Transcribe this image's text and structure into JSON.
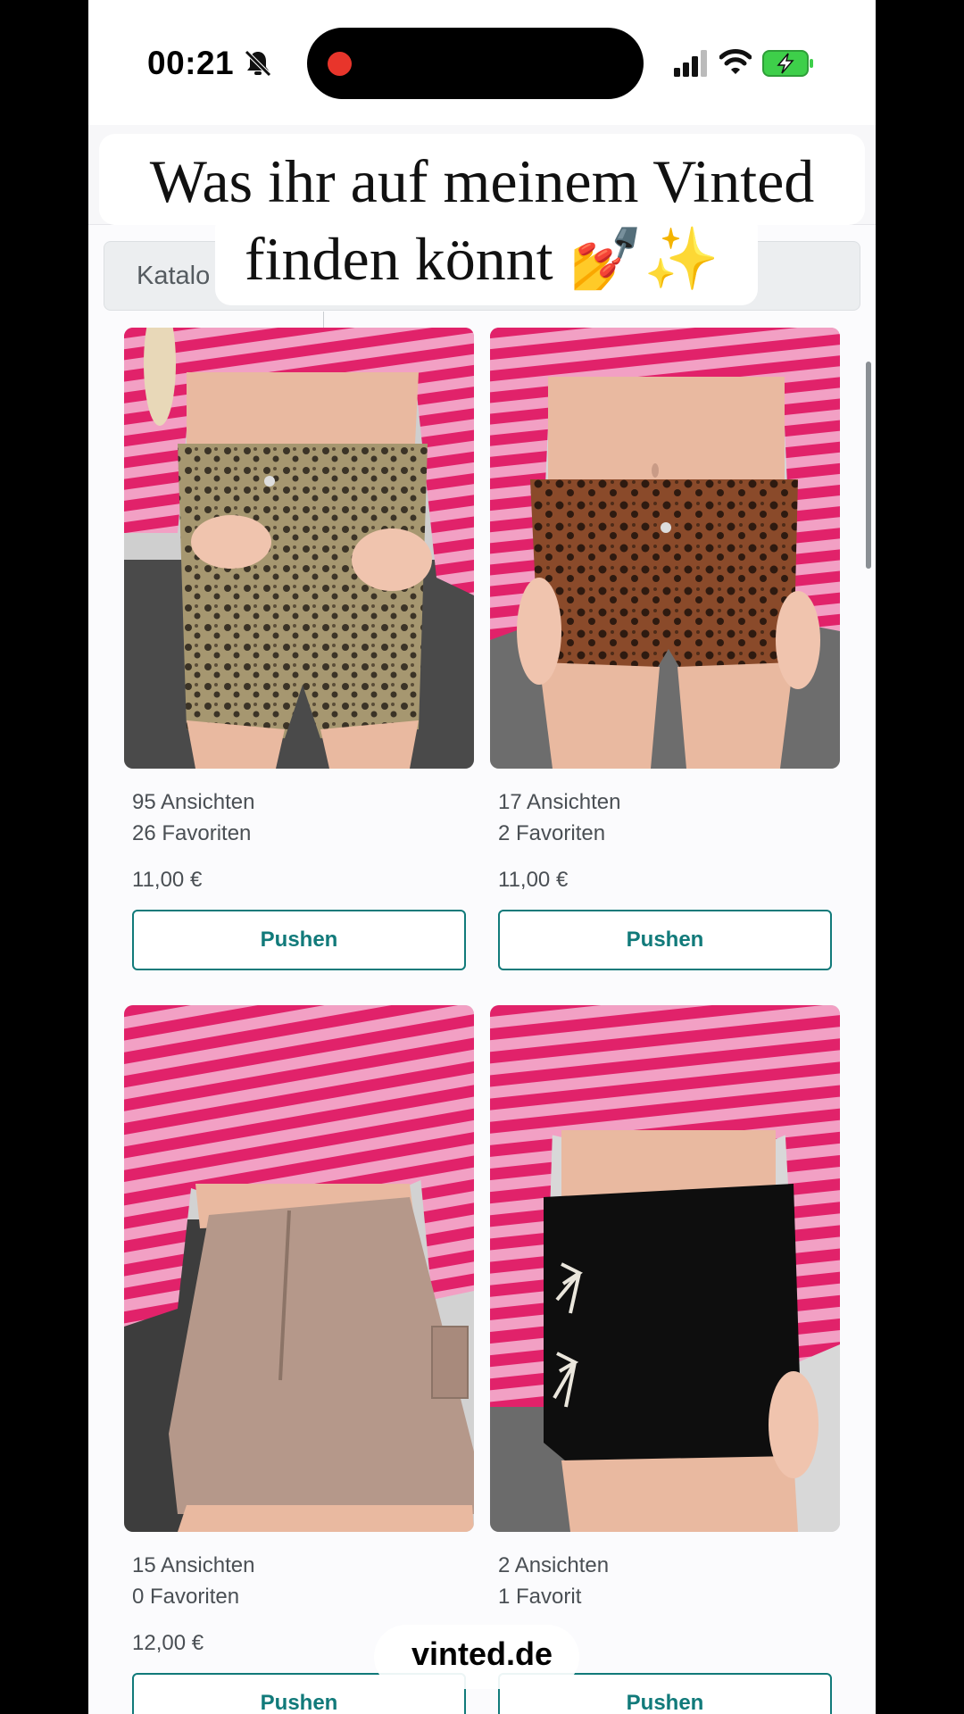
{
  "status_bar": {
    "time": "00:21",
    "icons": [
      "bell-slash-icon",
      "record-indicator-icon",
      "cellular-signal-icon",
      "wifi-icon",
      "battery-charging-icon"
    ],
    "battery_color": "#3ecf4a",
    "record_color": "#e8352b"
  },
  "search": {
    "label": "Katalo"
  },
  "caption": {
    "line1": "Was ihr auf meinem Vinted",
    "line2": "finden könnt 💅✨"
  },
  "accent_color": "#117a7a",
  "items": [
    {
      "views": "95 Ansichten",
      "favorites": "26 Favoriten",
      "price": "11,00 €",
      "button": "Pushen",
      "image": "leopard-print-shorts"
    },
    {
      "views": "17 Ansichten",
      "favorites": "2 Favoriten",
      "price": "11,00 €",
      "button": "Pushen",
      "image": "brown-leopard-print-shorts"
    },
    {
      "views": "15 Ansichten",
      "favorites": "0 Favoriten",
      "price": "12,00 €",
      "button": "Pushen",
      "image": "beige-cargo-mini-skirt"
    },
    {
      "views": "2 Ansichten",
      "favorites": "1 Favorit",
      "price": "",
      "button": "Pushen",
      "image": "black-mini-skirt-with-bows"
    }
  ],
  "watermark": "vinted.de"
}
